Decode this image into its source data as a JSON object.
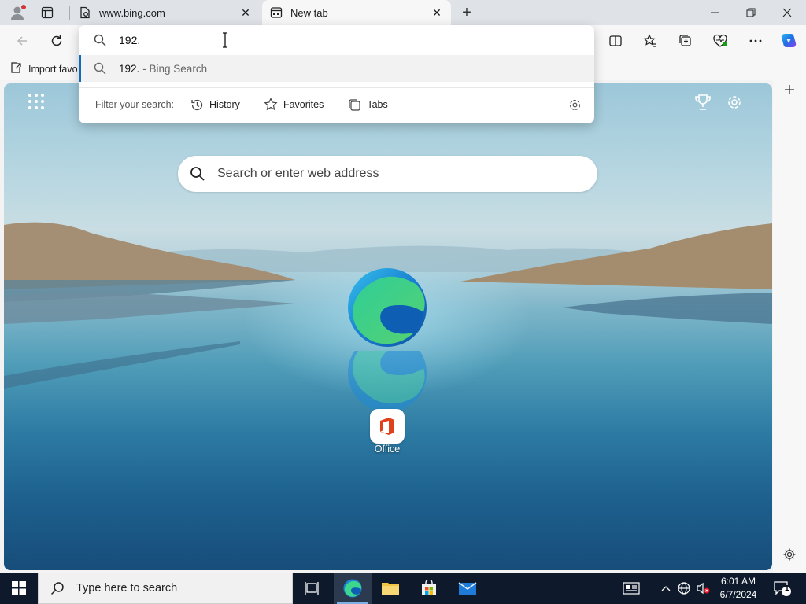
{
  "browser": {
    "tabs": [
      {
        "label": "www.bing.com"
      },
      {
        "label": "New tab",
        "active": true
      }
    ]
  },
  "omnibox": {
    "value": "192.",
    "suggestion": {
      "query": "192.",
      "suffix": "- Bing Search"
    },
    "filter_label": "Filter your search:",
    "filters": [
      "History",
      "Favorites",
      "Tabs"
    ]
  },
  "favorites_bar": {
    "import_label": "Import favo"
  },
  "ntp": {
    "search_placeholder": "Search or enter web address",
    "quick_links": [
      {
        "label": "Office"
      }
    ]
  },
  "taskbar": {
    "search_placeholder": "Type here to search",
    "clock_time": "6:01 AM",
    "clock_date": "6/7/2024",
    "notification_count": "1"
  },
  "colors": {
    "accent": "#0f6cbd",
    "taskbar_bg": "#0e1a2b",
    "tabstrip_bg": "#dfe3e8"
  }
}
